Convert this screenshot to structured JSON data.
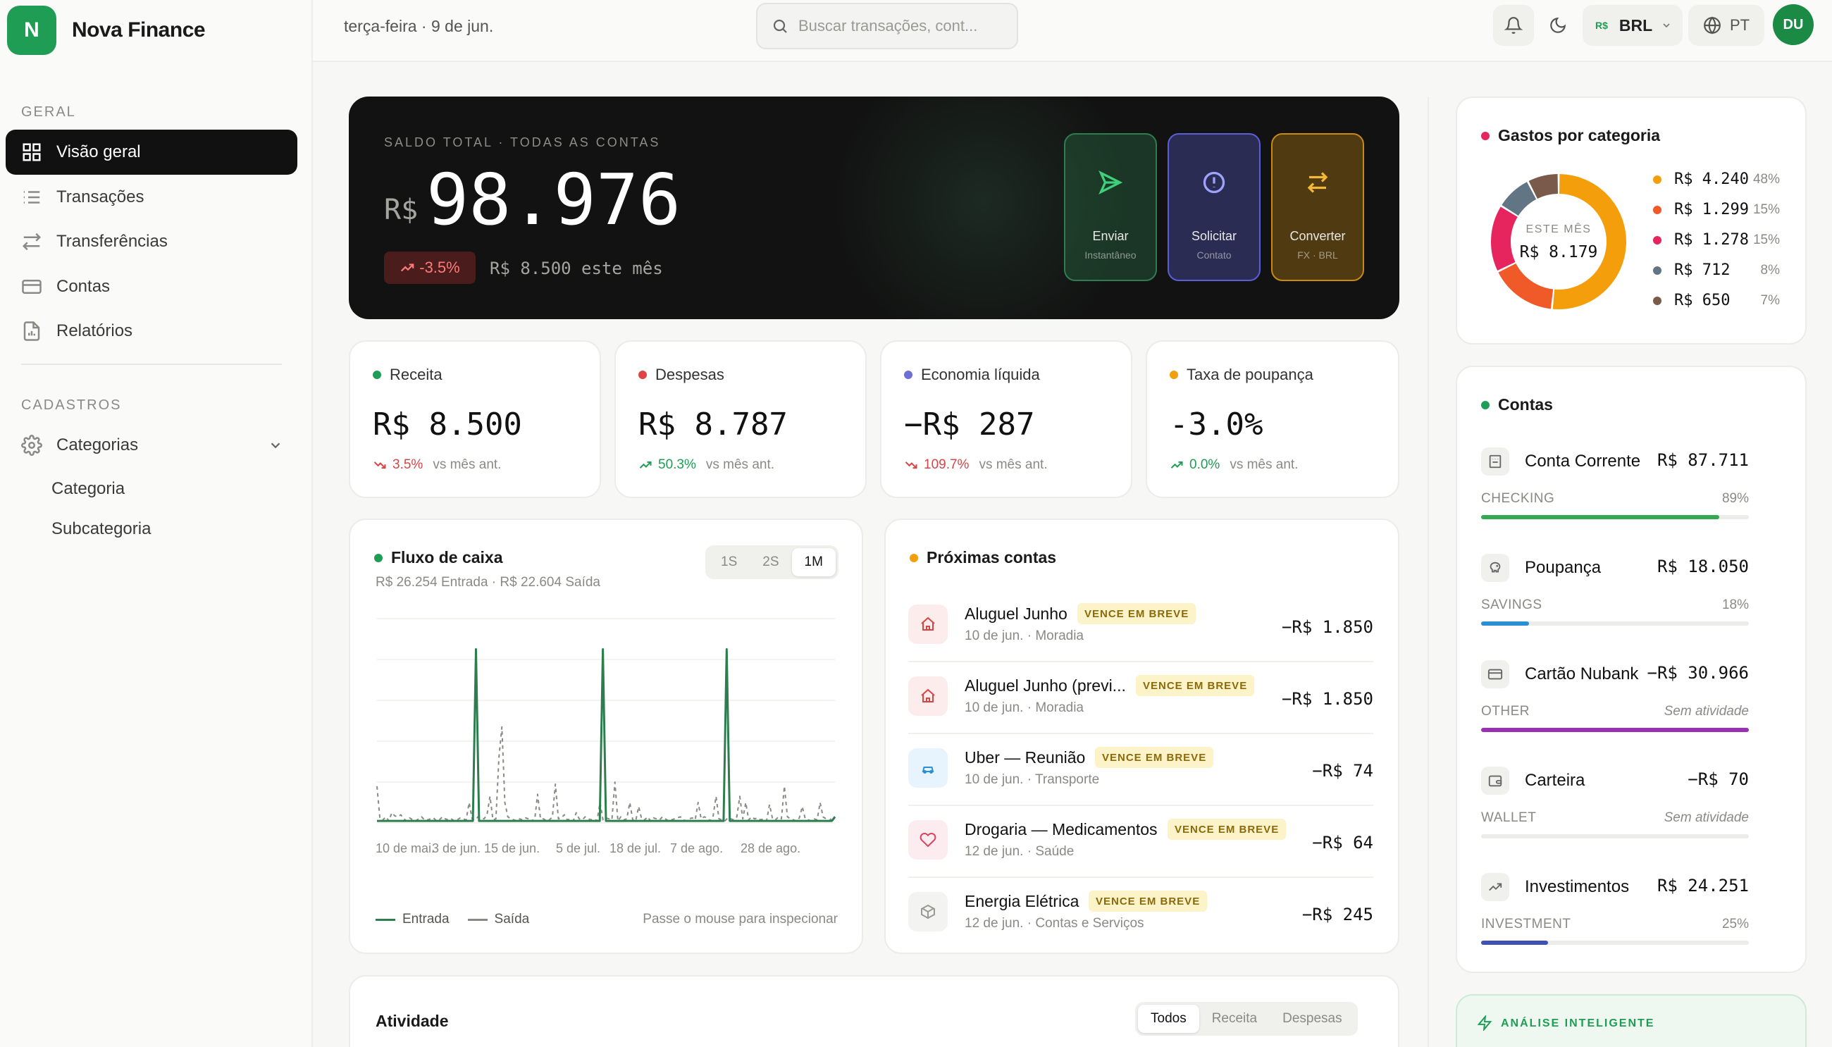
{
  "brand": {
    "initial": "N",
    "name": "Nova Finance"
  },
  "sidebar": {
    "section_main": "GERAL",
    "items": [
      {
        "label": "Visão geral",
        "icon": "grid-icon",
        "active": true
      },
      {
        "label": "Transações",
        "icon": "list-icon"
      },
      {
        "label": "Transferências",
        "icon": "arrows-icon"
      },
      {
        "label": "Contas",
        "icon": "card-icon"
      },
      {
        "label": "Relatórios",
        "icon": "document-icon"
      }
    ],
    "section_reg": "CADASTROS",
    "categories_label": "Categorias",
    "sub_items": [
      "Categoria",
      "Subcategoria"
    ]
  },
  "topbar": {
    "date": "terça-feira · 9 de jun.",
    "search_placeholder": "Buscar transações, cont...",
    "currency": "BRL",
    "currency_symbol": "R$",
    "language": "PT",
    "avatar": "DU"
  },
  "hero": {
    "label": "SALDO TOTAL · TODAS AS CONTAS",
    "currency": "R$",
    "value": "98.976",
    "change": "-3.5%",
    "month": "R$ 8.500 este mês",
    "actions": [
      {
        "label": "Enviar",
        "sub": "Instantâneo",
        "icon": "send-icon",
        "color": "#2e7d4f"
      },
      {
        "label": "Solicitar",
        "sub": "Contato",
        "icon": "alert-circle-icon",
        "color": "#5a5fd6"
      },
      {
        "label": "Converter",
        "sub": "FX · BRL",
        "icon": "swap-icon",
        "color": "#c98a12"
      }
    ]
  },
  "stats": [
    {
      "title": "Receita",
      "value": "R$ 8.500",
      "pct": "3.5%",
      "trend": "down",
      "note": "vs mês ant.",
      "dot": "#1f9d55"
    },
    {
      "title": "Despesas",
      "value": "R$ 8.787",
      "pct": "50.3%",
      "trend": "up",
      "note": "vs mês ant.",
      "dot": "#e04545"
    },
    {
      "title": "Economia líquida",
      "value": "−R$ 287",
      "pct": "109.7%",
      "trend": "down",
      "note": "vs mês ant.",
      "dot": "#6b6fd6"
    },
    {
      "title": "Taxa de poupança",
      "value": "-3.0%",
      "pct": "0.0%",
      "trend": "up",
      "note": "vs mês ant.",
      "dot": "#f59e0b"
    }
  ],
  "cashflow": {
    "title": "Fluxo de caixa",
    "subtitle": "R$ 26.254 Entrada · R$ 22.604 Saída",
    "tabs": [
      "1S",
      "2S",
      "1M"
    ],
    "active_tab": "1M",
    "legend_in": "Entrada",
    "legend_out": "Saída",
    "hint": "Passe o mouse para inspecionar"
  },
  "chart_data": {
    "type": "line",
    "x_labels": [
      "10 de mai.",
      "3 de jun.",
      "15 de jun.",
      "5 de jul.",
      "18 de jul.",
      "7 de ago.",
      "28 de ago."
    ],
    "ylim": [
      0,
      10000
    ],
    "grid": true,
    "legend_placement": "bottom-left",
    "series": [
      {
        "name": "Entrada",
        "style": "solid",
        "color": "#2e7d4f",
        "values": [
          100,
          100,
          100,
          100,
          100,
          100,
          100,
          100,
          100,
          100,
          100,
          100,
          100,
          100,
          100,
          100,
          100,
          100,
          100,
          100,
          100,
          100,
          100,
          100,
          100,
          100,
          100,
          100,
          100,
          100,
          100,
          100,
          8500,
          100,
          100,
          100,
          100,
          100,
          100,
          100,
          100,
          100,
          100,
          100,
          100,
          100,
          100,
          100,
          100,
          100,
          100,
          100,
          100,
          100,
          100,
          100,
          100,
          100,
          100,
          100,
          100,
          100,
          100,
          100,
          100,
          100,
          100,
          100,
          100,
          100,
          100,
          100,
          100,
          8500,
          100,
          100,
          100,
          100,
          100,
          100,
          100,
          100,
          100,
          100,
          100,
          100,
          100,
          100,
          100,
          100,
          100,
          100,
          100,
          100,
          100,
          100,
          100,
          100,
          100,
          100,
          100,
          100,
          100,
          100,
          100,
          100,
          100,
          100,
          100,
          100,
          100,
          100,
          100,
          8500,
          100,
          100,
          100,
          100,
          100,
          100,
          100,
          100,
          100,
          100,
          100,
          100,
          100,
          100,
          100,
          100,
          100,
          100,
          100,
          100,
          100,
          100,
          100,
          100,
          100,
          100,
          100,
          100,
          100,
          100,
          100,
          100,
          100,
          100,
          300
        ]
      },
      {
        "name": "Saída",
        "style": "dashed",
        "color": "#8a8a85",
        "values": [
          1800,
          200,
          150,
          300,
          100,
          500,
          350,
          300,
          400,
          200,
          100,
          250,
          150,
          100,
          200,
          300,
          150,
          150,
          200,
          250,
          100,
          150,
          300,
          200,
          150,
          200,
          100,
          150,
          250,
          200,
          150,
          1000,
          200,
          150,
          300,
          250,
          200,
          400,
          1300,
          150,
          200,
          3200,
          4700,
          1000,
          300,
          200,
          150,
          100,
          200,
          150,
          250,
          200,
          150,
          100,
          1400,
          200,
          200,
          100,
          150,
          300,
          1900,
          200,
          250,
          400,
          150,
          200,
          100,
          500,
          200,
          150,
          300,
          200,
          150,
          200,
          100,
          1000,
          150,
          250,
          200,
          150,
          2000,
          100,
          300,
          150,
          200,
          1000,
          150,
          100,
          800,
          200,
          150,
          300,
          100,
          250,
          200,
          150,
          300,
          200,
          100,
          150,
          200,
          250,
          300,
          150,
          100,
          200,
          250,
          150,
          1000,
          200,
          300,
          250,
          100,
          300,
          1300,
          200,
          150,
          100,
          250,
          200,
          150,
          300,
          1300,
          200,
          1000,
          150,
          300,
          200,
          250,
          150,
          200,
          100,
          900,
          200,
          150,
          300,
          200,
          1800,
          300,
          200,
          150,
          100,
          250,
          800,
          200,
          150,
          100,
          200,
          150,
          1000,
          300,
          200,
          100,
          250,
          300
        ]
      }
    ]
  },
  "bills": {
    "title": "Próximas contas",
    "badge": "VENCE EM BREVE",
    "items": [
      {
        "name": "Aluguel Junho",
        "sub": "10 de jun. · Moradia",
        "amount": "−R$ 1.850",
        "icon": "home-icon",
        "tone": "#fdecec",
        "color": "#d64545"
      },
      {
        "name": "Aluguel Junho (previ...",
        "sub": "10 de jun. · Moradia",
        "amount": "−R$ 1.850",
        "icon": "home-icon",
        "tone": "#fdecec",
        "color": "#d64545"
      },
      {
        "name": "Uber — Reunião",
        "sub": "10 de jun. · Transporte",
        "amount": "−R$ 74",
        "icon": "car-icon",
        "tone": "#e8f4fd",
        "color": "#2b8fd4"
      },
      {
        "name": "Drogaria — Medicamentos",
        "sub": "12 de jun. · Saúde",
        "amount": "−R$ 64",
        "icon": "heart-icon",
        "tone": "#fdecef",
        "color": "#d6455f"
      },
      {
        "name": "Energia Elétrica",
        "sub": "12 de jun. · Contas e Serviços",
        "amount": "−R$ 245",
        "icon": "box-icon",
        "tone": "#f3f3f1",
        "color": "#9a9a94"
      }
    ]
  },
  "activity": {
    "title": "Atividade",
    "tabs": [
      "Todos",
      "Receita",
      "Despesas"
    ],
    "active_tab": "Todos"
  },
  "spending": {
    "title": "Gastos por categoria",
    "center_label": "ESTE MÊS",
    "center_value": "R$ 8.179",
    "slices": [
      {
        "value": "R$ 4.240",
        "pct": "48%",
        "frac": 0.48,
        "color": "#f59e0b"
      },
      {
        "value": "R$ 1.299",
        "pct": "15%",
        "frac": 0.15,
        "color": "#f05a28"
      },
      {
        "value": "R$ 1.278",
        "pct": "15%",
        "frac": 0.15,
        "color": "#e6245e"
      },
      {
        "value": "R$ 712",
        "pct": "8%",
        "frac": 0.08,
        "color": "#627584"
      },
      {
        "value": "R$ 650",
        "pct": "7%",
        "frac": 0.07,
        "color": "#7a5a4a"
      }
    ]
  },
  "accounts": {
    "title": "Contas",
    "items": [
      {
        "name": "Conta Corrente",
        "amount": "R$ 87.711",
        "type": "CHECKING",
        "pct": "89%",
        "frac": 0.89,
        "color": "#34a853",
        "italic": false,
        "icon": "bank-icon"
      },
      {
        "name": "Poupança",
        "amount": "R$ 18.050",
        "type": "SAVINGS",
        "pct": "18%",
        "frac": 0.18,
        "color": "#2b8fd4",
        "italic": false,
        "icon": "piggy-icon"
      },
      {
        "name": "Cartão Nubank",
        "amount": "−R$ 30.966",
        "type": "OTHER",
        "pct": "Sem atividade",
        "frac": 1.0,
        "color": "#9b2fb5",
        "italic": true,
        "icon": "card-icon"
      },
      {
        "name": "Carteira",
        "amount": "−R$ 70",
        "type": "WALLET",
        "pct": "Sem atividade",
        "frac": 0,
        "color": "#cccccc",
        "italic": true,
        "icon": "wallet-icon"
      },
      {
        "name": "Investimentos",
        "amount": "R$ 24.251",
        "type": "INVESTMENT",
        "pct": "25%",
        "frac": 0.25,
        "color": "#3f51b5",
        "italic": false,
        "icon": "trend-icon"
      }
    ]
  },
  "ai": {
    "label": "ANÁLISE INTELIGENTE"
  }
}
